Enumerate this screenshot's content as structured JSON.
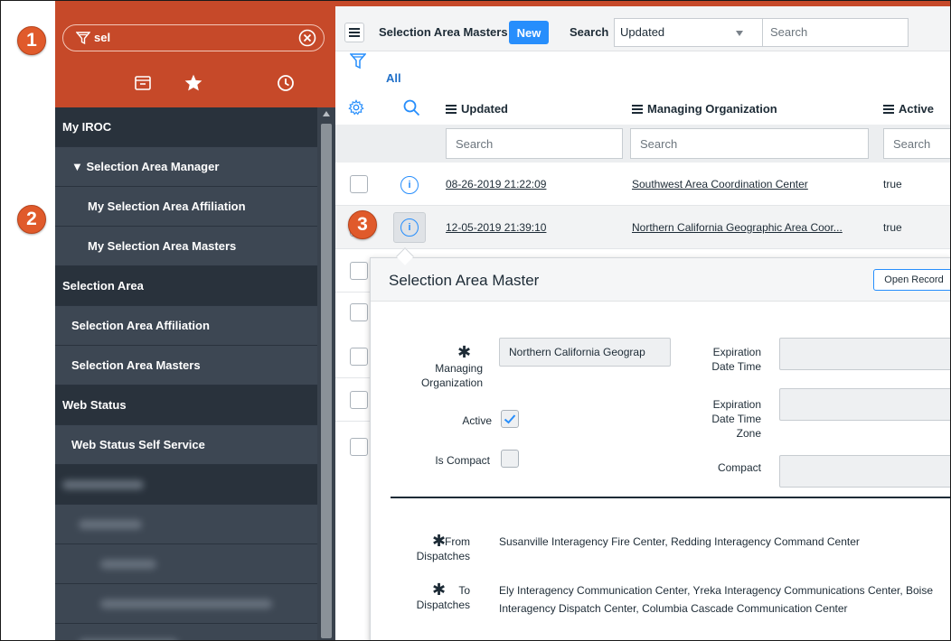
{
  "markers": [
    "1",
    "2",
    "3"
  ],
  "navigator": {
    "filter_value": "sel",
    "tabs": [
      "archive-icon",
      "star-icon",
      "history-icon"
    ],
    "items": [
      {
        "label": "My IROC",
        "kind": "app"
      },
      {
        "label": "▼ Selection Area Manager",
        "kind": "module"
      },
      {
        "label": "My Selection Area Affiliation",
        "kind": "sub"
      },
      {
        "label": "My Selection Area Masters",
        "kind": "sub"
      },
      {
        "label": "Selection Area",
        "kind": "app"
      },
      {
        "label": "Selection Area Affiliation",
        "kind": "module"
      },
      {
        "label": "Selection Area Masters",
        "kind": "module"
      },
      {
        "label": "Web Status",
        "kind": "app"
      },
      {
        "label": "Web Status Self Service",
        "kind": "module"
      }
    ]
  },
  "toolbar": {
    "title": "Selection Area Masters",
    "new_label": "New",
    "search_label": "Search",
    "sort_value": "Updated",
    "search_placeholder": "Search"
  },
  "breadcrumb": {
    "all_label": "All"
  },
  "table": {
    "columns": [
      "Updated",
      "Managing Organization",
      "Active"
    ],
    "search_placeholder": "Search",
    "rows": [
      {
        "updated": "08-26-2019 21:22:09",
        "organization": "Southwest Area Coordination Center",
        "active": "true"
      },
      {
        "updated": "12-05-2019 21:39:10",
        "organization": "Northern California Geographic Area Coor...",
        "active": "true"
      }
    ],
    "info_glyph": "i"
  },
  "preview": {
    "title": "Selection Area Master",
    "open_record_label": "Open Record",
    "required_mark": "✱",
    "fields": {
      "managing_org_label": "Managing Organization",
      "managing_org_value": "Northern California Geograp",
      "active_label": "Active",
      "active_checked": true,
      "is_compact_label": "Is Compact",
      "expiration_label": "Expiration Date Time",
      "expiration_zone_label": "Expiration Date Time Zone",
      "compact_label": "Compact",
      "from_label": "From Dispatches",
      "from_value": "Susanville Interagency Fire Center, Redding Interagency Command Center",
      "to_label": "To Dispatches",
      "to_value": "Ely Interagency Communication Center, Yreka Interagency Communications Center, Boise Interagency Dispatch Center, Columbia Cascade Communication Center"
    }
  },
  "colors": {
    "accent": "#c64929",
    "nav_bg": "#303a46",
    "primary_button": "#278efc",
    "marker": "#e05a2b"
  }
}
